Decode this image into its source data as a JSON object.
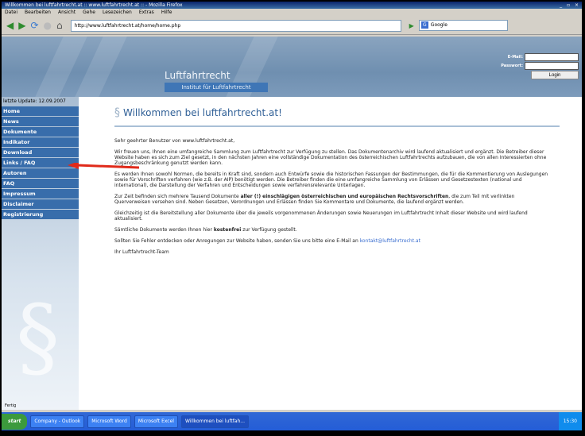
{
  "window": {
    "title": "Willkommen bei luftfahrtrecht.at :: www.luftfahrtrecht.at :: - Mozilla Firefox",
    "controls": "_ ▫ ×"
  },
  "menu": [
    "Datei",
    "Bearbeiten",
    "Ansicht",
    "Gehe",
    "Lesezeichen",
    "Extras",
    "Hilfe"
  ],
  "toolbar": {
    "url": "http://www.luftfahrtrecht.at/home/home.php",
    "search_placeholder": "Google",
    "google_label": "G"
  },
  "header": {
    "title": "Luftfahrtrecht",
    "subtitle": "Institut für Luftfahrtrecht"
  },
  "login": {
    "email_label": "E-Mail:",
    "password_label": "Passwort:",
    "button": "Login"
  },
  "sidebar": {
    "update": "letzte Update: 12.09.2007",
    "items": [
      "Home",
      "News",
      "Dokumente",
      "Indikator",
      "Download",
      "Links / FAQ",
      "Autoren",
      "FAQ",
      "Impressum",
      "Disclaimer",
      "Registrierung"
    ]
  },
  "content": {
    "heading_symbol": "§",
    "heading": "Willkommen bei luftfahrtrecht.at!",
    "p1": "Sehr geehrter Benutzer von www.luftfahrtrecht.at,",
    "p2": "Wir freuen uns, Ihnen eine umfangreiche Sammlung zum Luftfahrtrecht zur Verfügung zu stellen. Das Dokumentenarchiv wird laufend aktualisiert und ergänzt. Die Betreiber dieser Website haben es sich zum Ziel gesetzt, in den nächsten Jahren eine vollständige Dokumentation des österreichischen Luftfahrtrechts aufzubauen, die von allen Interessierten ohne Zugangsbeschränkung genutzt werden kann.",
    "p3": "Es werden Ihnen sowohl Normen, die bereits in Kraft sind, sondern auch Entwürfe sowie die historischen Fassungen der Bestimmungen, die für die Kommentierung von Auslegungen sowie für Vorschriften verfahren (wie z.B. der AIP) benötigt werden. Die Betreiber finden die eine umfangreiche Sammlung von Erlässen und Gesetzestexten (national und international), die Darstellung der Verfahren und Entscheidungen sowie verfahrensrelevante Unterlagen.",
    "p4_pre": "Zur Zeit befinden sich mehrere Tausend Dokumente ",
    "p4_bold": "aller (!) einschlägigen österreichischen und europäischen Rechtsvorschriften",
    "p4_post": ", die zum Teil mit verlinkten Querverweisen versehen sind. Neben Gesetzen, Verordnungen und Erlässen finden Sie Kommentare und Dokumente, die laufend ergänzt werden.",
    "p5": "Gleichzeitig ist die Bereitstellung aller Dokumente über die jeweils vorgenommenen Änderungen sowie Neuerungen im Luftfahrtrecht Inhalt dieser Website und wird laufend aktualisiert.",
    "p6_pre": "Sämtliche Dokumente werden Ihnen hier ",
    "p6_bold": "kostenfrei",
    "p6_post": " zur Verfügung gestellt.",
    "p7_pre": "Sollten Sie Fehler entdecken oder Anregungen zur Website haben, senden Sie uns bitte eine E-Mail an ",
    "p7_link": "kontakt@luftfahrtrecht.at",
    "p8": "Ihr Luftfahrtrecht-Team"
  },
  "status": "Fertig",
  "taskbar": {
    "start": "start",
    "tasks": [
      "Company - Outlook",
      "Microsoft Word",
      "Microsoft Excel",
      "Willkommen bei luftfah..."
    ],
    "clock": "15:30"
  }
}
